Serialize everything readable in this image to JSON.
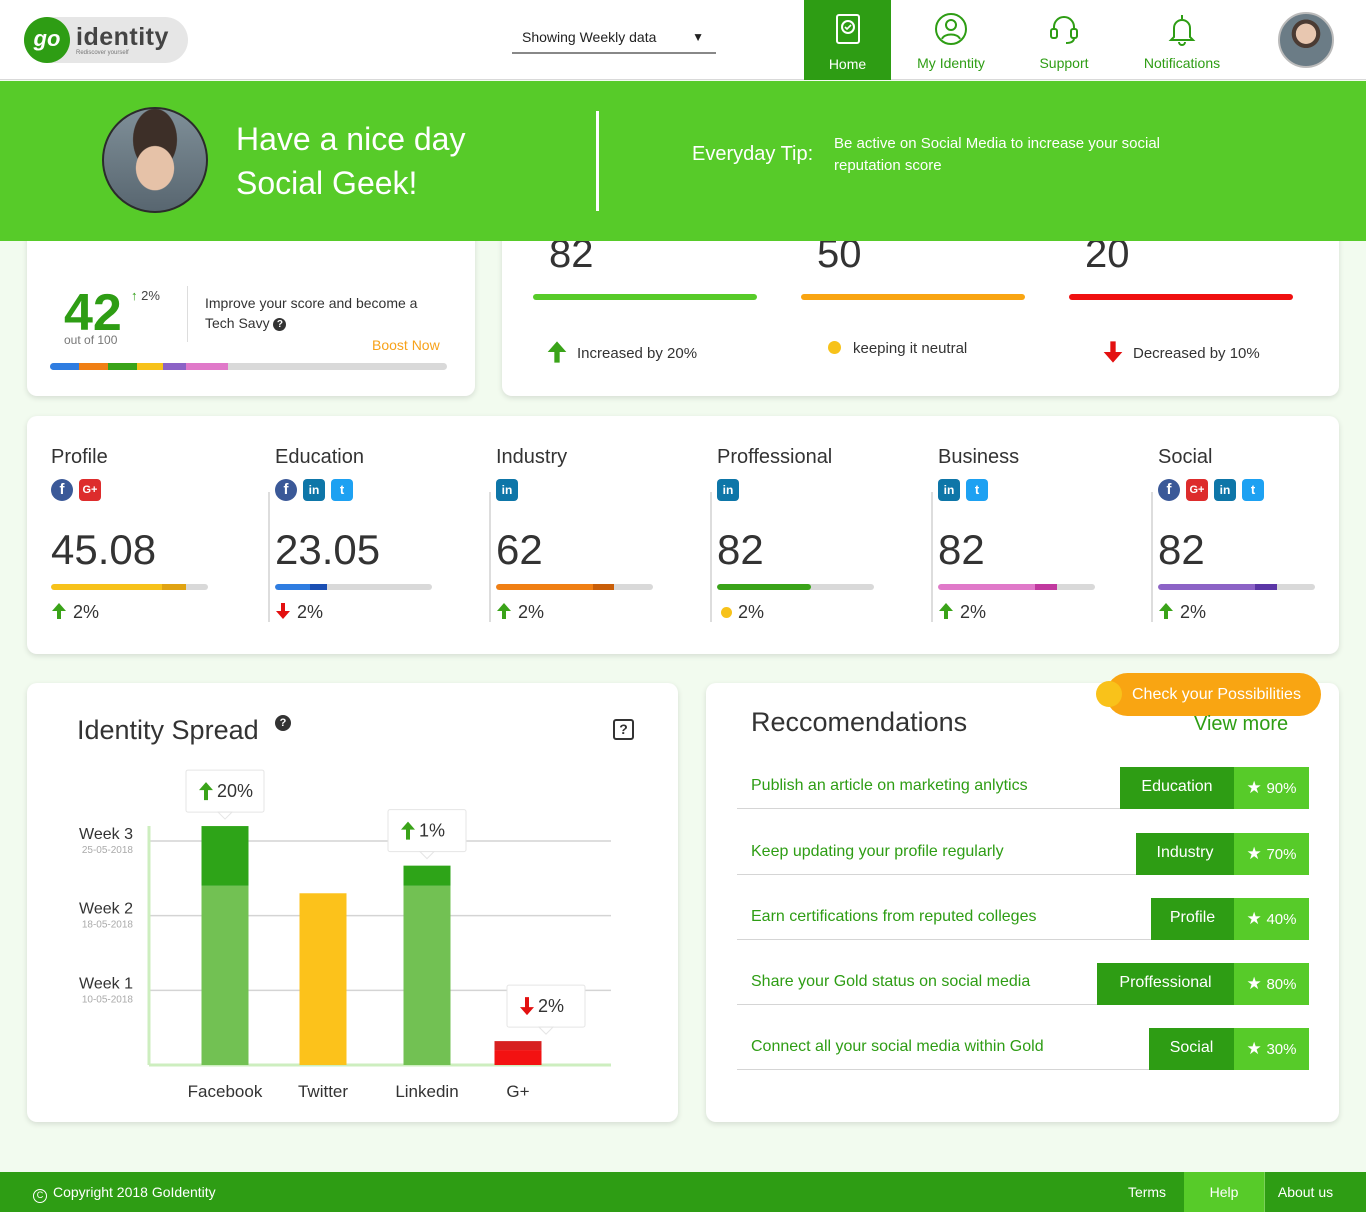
{
  "header": {
    "logo_mark": "go",
    "logo_word": "identity",
    "logo_tagline": "Rediscover yourself",
    "period_select": "Showing Weekly data",
    "nav": [
      {
        "label": "Home",
        "icon": "home-icon",
        "active": true
      },
      {
        "label": "My Identity",
        "icon": "identity-icon"
      },
      {
        "label": "Support",
        "icon": "headset-icon"
      },
      {
        "label": "Notifications",
        "icon": "bell-icon"
      }
    ]
  },
  "banner": {
    "greeting_line1": "Have a nice day",
    "greeting_line2": "Social Geek!",
    "tip_label": "Everyday Tip:",
    "tip_text": "Be active on Social Media to increase your social reputation score"
  },
  "score": {
    "value": "42",
    "delta": "2%",
    "sub": "out of 100",
    "message": "Improve your score and become a Tech Savy",
    "boost": "Boost Now",
    "progress_segments": [
      {
        "color": "#2f7de1",
        "fraction": 0.073
      },
      {
        "color": "#f07f14",
        "fraction": 0.073
      },
      {
        "color": "#3aa319",
        "fraction": 0.073
      },
      {
        "color": "#f7c21a",
        "fraction": 0.065
      },
      {
        "color": "#8c63c6",
        "fraction": 0.058
      },
      {
        "color": "#e079c9",
        "fraction": 0.106
      }
    ]
  },
  "overall": [
    {
      "value": "82",
      "color": "#57cb29",
      "note": "Increased by 20%",
      "trend": "up"
    },
    {
      "value": "50",
      "color": "#f9a512",
      "note": "keeping it neutral",
      "trend": "neutral"
    },
    {
      "value": "20",
      "color": "#f01010",
      "note": "Decreased by 10%",
      "trend": "down"
    }
  ],
  "categories": [
    {
      "name": "Profile",
      "icons": [
        "facebook",
        "google-plus"
      ],
      "value": "45.08",
      "fill": 0.86,
      "fill_color": "#f7c21a",
      "accent_color": "#e0a312",
      "accent_from": 0.71,
      "delta": "2%",
      "trend": "up"
    },
    {
      "name": "Education",
      "icons": [
        "facebook",
        "linkedin",
        "twitter"
      ],
      "value": "23.05",
      "fill": 0.33,
      "fill_color": "#2f7de1",
      "accent_color": "#1a4fb3",
      "accent_from": 0.22,
      "delta": "2%",
      "trend": "down"
    },
    {
      "name": "Industry",
      "icons": [
        "linkedin"
      ],
      "value": "62",
      "fill": 0.75,
      "fill_color": "#f07f14",
      "accent_color": "#c95e08",
      "accent_from": 0.62,
      "delta": "2%",
      "trend": "up"
    },
    {
      "name": "Proffessional",
      "icons": [
        "linkedin"
      ],
      "value": "82",
      "fill": 0.6,
      "fill_color": "#3aa319",
      "accent_color": "#3aa319",
      "accent_from": 0.6,
      "delta": "2%",
      "trend": "neutral"
    },
    {
      "name": "Business",
      "icons": [
        "linkedin",
        "twitter"
      ],
      "value": "82",
      "fill": 0.76,
      "fill_color": "#e079c9",
      "accent_color": "#c1399f",
      "accent_from": 0.62,
      "delta": "2%",
      "trend": "up"
    },
    {
      "name": "Social",
      "icons": [
        "facebook",
        "google-plus",
        "linkedin",
        "twitter"
      ],
      "value": "82",
      "fill": 0.76,
      "fill_color": "#8c63c6",
      "accent_color": "#5b36a6",
      "accent_from": 0.62,
      "delta": "2%",
      "trend": "up"
    }
  ],
  "spread": {
    "title": "Identity Spread",
    "help_icon": "question-circle-icon",
    "expand_icon": "question-square-icon"
  },
  "chart_data": {
    "type": "bar",
    "categories": [
      "Facebook",
      "Twitter",
      "Linkedin",
      "G+"
    ],
    "y_ticks": [
      {
        "label": "Week 1",
        "date": "10-05-2018",
        "value": 1
      },
      {
        "label": "Week 2",
        "date": "18-05-2018",
        "value": 2
      },
      {
        "label": "Week 3",
        "date": "25-05-2018",
        "value": 3
      }
    ],
    "ylim": [
      0,
      3.3
    ],
    "series": [
      {
        "values": [
          2.4,
          2.3,
          2.4,
          0.2
        ],
        "colors": [
          "#72c153",
          "#fcc21b",
          "#72c153",
          "#f31212"
        ]
      },
      {
        "values": [
          0.8,
          0,
          0.27,
          0.12
        ],
        "colors": [
          "#2ea418",
          "#fcc21b",
          "#2ea418",
          "#d72020"
        ]
      }
    ],
    "annotations": [
      {
        "category": "Facebook",
        "text": "20%",
        "trend": "up"
      },
      {
        "category": "Linkedin",
        "text": "1%",
        "trend": "up"
      },
      {
        "category": "G+",
        "text": "2%",
        "trend": "down"
      }
    ],
    "grid": true
  },
  "recos": {
    "title": "Reccomendations",
    "cta": "Check your Possibilities",
    "view_more": "View more",
    "items": [
      {
        "text": "Publish an article on marketing anlytics",
        "tag": "Education",
        "pct": "90%"
      },
      {
        "text": "Keep updating your profile regularly",
        "tag": "Industry",
        "pct": "70%"
      },
      {
        "text": "Earn certifications from reputed colleges",
        "tag": "Profile",
        "pct": "40%"
      },
      {
        "text": "Share your Gold status on social media",
        "tag": "Proffessional",
        "pct": "80%"
      },
      {
        "text": "Connect all your social media within Gold",
        "tag": "Social",
        "pct": "30%"
      }
    ]
  },
  "footer": {
    "copyright": "Copyright 2018 GoIdentity",
    "links": [
      "Terms",
      "Help",
      "About us"
    ]
  }
}
